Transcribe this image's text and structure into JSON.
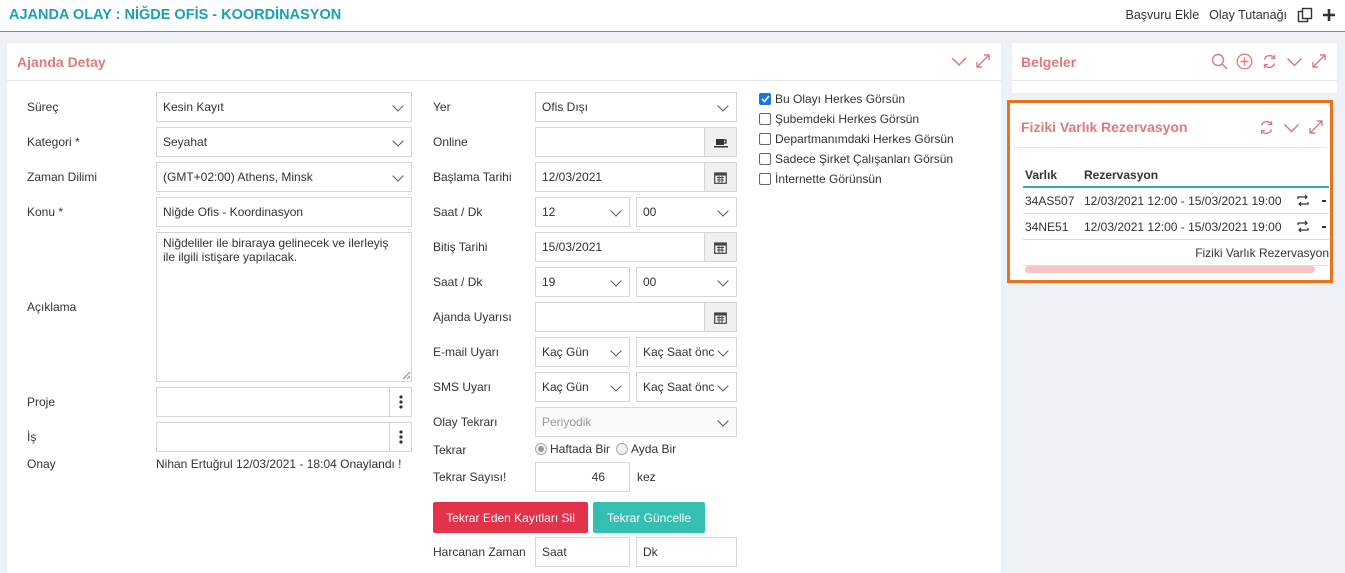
{
  "page": {
    "title": "AJANDA OLAY : NİĞDE OFİS - KOORDİNASYON"
  },
  "top_actions": {
    "basvuru": "Başvuru Ekle",
    "tutanak": "Olay Tutanağı"
  },
  "detail": {
    "title": "Ajanda Detay",
    "labels": {
      "surec": "Süreç",
      "kategori": "Kategori *",
      "zaman": "Zaman Dilimi",
      "konu": "Konu *",
      "aciklama": "Açıklama",
      "proje": "Proje",
      "is": "İş",
      "onay": "Onay",
      "yer": "Yer",
      "online": "Online",
      "baslama": "Başlama Tarihi",
      "saat1": "Saat / Dk",
      "bitis": "Bitiş Tarihi",
      "saat2": "Saat / Dk",
      "uyari": "Ajanda Uyarısı",
      "email": "E-mail Uyarı",
      "sms": "SMS Uyarı",
      "tekrari": "Olay Tekrarı",
      "tekrar": "Tekrar",
      "tekrar_sayisi": "Tekrar Sayısı!",
      "harcanan": "Harcanan Zaman"
    },
    "values": {
      "surec": "Kesin Kayıt",
      "kategori": "Seyahat",
      "zaman": "(GMT+02:00) Athens, Minsk",
      "konu": "Niğde Ofis - Koordinasyon",
      "aciklama": "Niğdeliler ile biraraya gelinecek ve ilerleyiş\nile ilgili istişare yapılacak.",
      "onay": "Nihan Ertuğrul 12/03/2021 - 18:04 Onaylandı !",
      "yer": "Ofis Dışı",
      "baslama": "12/03/2021",
      "saat1_h": "12",
      "saat1_m": "00",
      "bitis": "15/03/2021",
      "saat2_h": "19",
      "saat2_m": "00",
      "email_gun": "Kaç Gün",
      "email_saat": "Kaç Saat önc",
      "sms_gun": "Kaç Gün",
      "sms_saat": "Kaç Saat önc",
      "tekrari": "Periyodik",
      "radio1": "Haftada Bir",
      "radio2": "Ayda Bir",
      "tekrar_sayisi": "46",
      "kez": "kez",
      "harcanan_saat": "Saat",
      "harcanan_dk": "Dk"
    },
    "buttons": {
      "sil": "Tekrar Eden Kayıtları Sil",
      "guncelle": "Tekrar Güncelle"
    },
    "checkboxes": [
      {
        "label": "Bu Olayı Herkes Görsün",
        "checked": true
      },
      {
        "label": "Şubemdeki Herkes Görsün",
        "checked": false
      },
      {
        "label": "Departmanımdaki Herkes Görsün",
        "checked": false
      },
      {
        "label": "Sadece Şirket Çalışanları Görsün",
        "checked": false
      },
      {
        "label": "İnternette Görünsün",
        "checked": false
      }
    ]
  },
  "belgeler": {
    "title": "Belgeler"
  },
  "fiziki": {
    "title": "Fiziki Varlık Rezervasyon",
    "headers": [
      "Varlık",
      "Rezervasyon"
    ],
    "rows": [
      [
        "34AS507",
        "12/03/2021 12:00 - 15/03/2021 19:00"
      ],
      [
        "34NE51",
        "12/03/2021 12:00 - 15/03/2021 19:00"
      ]
    ],
    "footer": "Fiziki Varlık Rezervasyon"
  },
  "colors": {
    "accent": "#1aa0b5",
    "panel_title": "#e07a7a",
    "highlight": "#e8731a",
    "danger": "#e2334b",
    "teal": "#35bfb2"
  }
}
